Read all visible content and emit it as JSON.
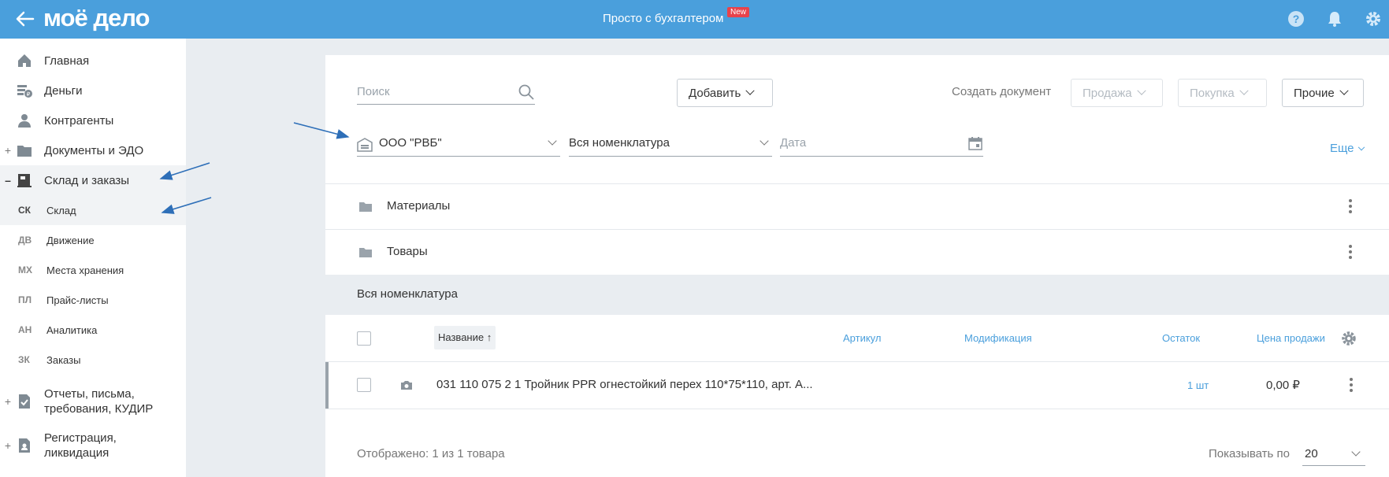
{
  "header": {
    "logo": "моё дело",
    "center_title": "Просто с бухгалтером",
    "badge": "New",
    "icons": [
      "help-icon",
      "bell-icon",
      "gear-icon"
    ]
  },
  "sidebar": {
    "items": [
      {
        "label": "Главная",
        "icon": "home-icon"
      },
      {
        "label": "Деньги",
        "icon": "money-icon"
      },
      {
        "label": "Контрагенты",
        "icon": "contacts-icon"
      },
      {
        "label": "Документы и ЭДО",
        "icon": "folder-icon",
        "expander": "+"
      },
      {
        "label": "Склад и заказы",
        "icon": "warehouse-icon",
        "expander": "–"
      }
    ],
    "subitems": [
      {
        "abbr": "СК",
        "label": "Склад"
      },
      {
        "abbr": "ДВ",
        "label": "Движение"
      },
      {
        "abbr": "МХ",
        "label": "Места хранения"
      },
      {
        "abbr": "ПЛ",
        "label": "Прайс-листы"
      },
      {
        "abbr": "АН",
        "label": "Аналитика"
      },
      {
        "abbr": "ЗК",
        "label": "Заказы"
      }
    ],
    "bottom_items": [
      {
        "line1": "Отчеты, письма,",
        "line2": "требования, КУДИР",
        "expander": "+"
      },
      {
        "line1": "Регистрация,",
        "line2": "ликвидация",
        "expander": "+"
      }
    ]
  },
  "toolbar": {
    "search_placeholder": "Поиск",
    "add_label": "Добавить",
    "create_doc_label": "Создать документ",
    "sale_label": "Продажа",
    "purchase_label": "Покупка",
    "other_label": "Прочие"
  },
  "filters": {
    "warehouse": "ООО \"РВБ\"",
    "nomenclature": "Вся номенклатура",
    "date_placeholder": "Дата",
    "more_label": "Еще"
  },
  "folders": [
    "Материалы",
    "Товары"
  ],
  "section_title": "Вся номенклатура",
  "table": {
    "columns": {
      "name": "Название ↑",
      "article": "Артикул",
      "modification": "Модификация",
      "stock": "Остаток",
      "price": "Цена продажи"
    },
    "rows": [
      {
        "name": "031 110 075 2 1 Тройник PPR огнестойкий перех 110*75*110, арт. А...",
        "stock": "1 шт",
        "price": "0,00 ₽"
      }
    ]
  },
  "footer": {
    "shown": "Отображено: 1 из 1 товара",
    "page_size_label": "Показывать по",
    "page_size": "20"
  },
  "colors": {
    "header_bg": "#4a9fdc",
    "accent": "#4a9fdc",
    "badge": "#e8434c",
    "annotation_arrow": "#2e6fb8"
  }
}
